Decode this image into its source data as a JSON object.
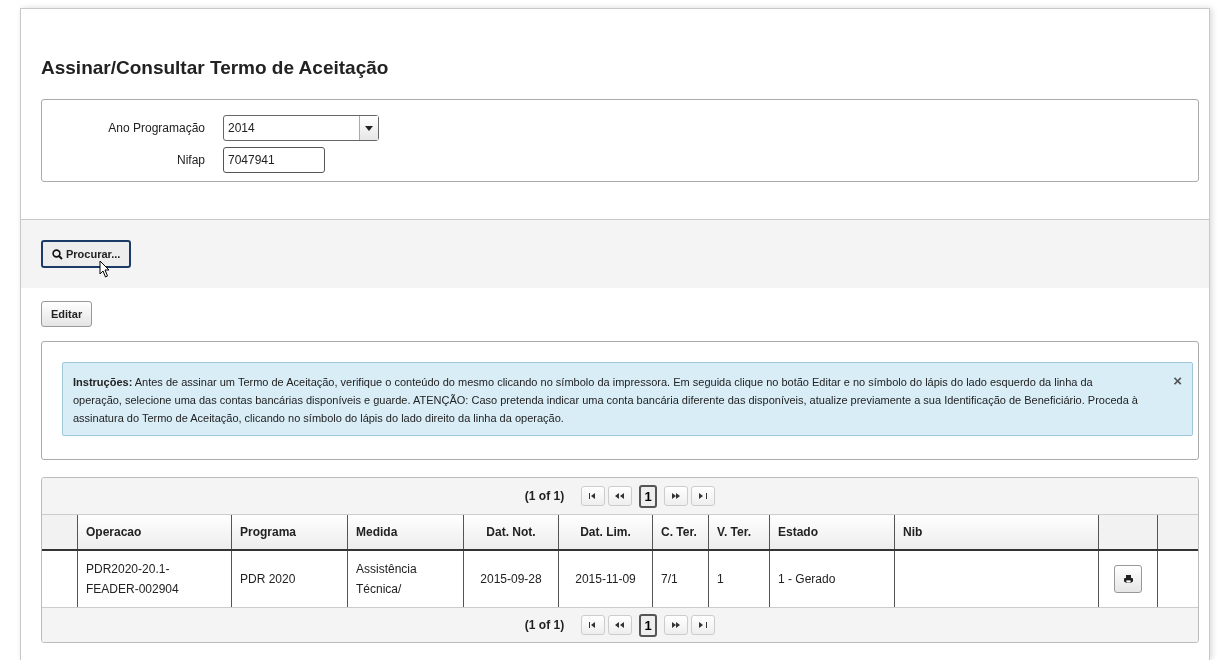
{
  "page_title": "Assinar/Consultar Termo de Aceitação",
  "form": {
    "fields": [
      {
        "kind": "select",
        "label": "Ano Programação",
        "value": "2014"
      },
      {
        "kind": "text",
        "label": "Nifap",
        "value": "7047941"
      }
    ]
  },
  "search_button": {
    "label": "Procurar...",
    "hovered": true
  },
  "edit_button": {
    "label": "Editar"
  },
  "instructions": {
    "text": "**Instruções:** Antes de assinar um Termo de Aceitação, verifique o conteúdo do mesmo clicando no símbolo da impressora. Em seguida clique no botão Editar e no símbolo do lápis do lado esquerdo da linha da operação, selecione uma das contas bancárias disponíveis e guarde. ATENÇÃO: Caso pretenda indicar uma conta bancária diferente das disponíveis, atualize previamente a sua Identificação de Beneficiário. Proceda à assinatura do Termo de Aceitação, clicando no símbolo do lápis do lado direito da linha da operação.",
    "close": "×"
  },
  "table": {
    "top_pager": {
      "info": "(1 of 1)",
      "pages": [
        {
          "label": "1",
          "selected": true
        }
      ]
    },
    "columns": [
      "Operacao",
      "Programa",
      "Medida",
      "Dat. Not.",
      "Dat. Lim.",
      "C. Ter.",
      "V. Ter.",
      "Estado",
      "Nib"
    ],
    "rows": [
      {
        "cells": [
          "PDR2020-20.1-FEADER-002904",
          "PDR 2020",
          "Assistência Técnica/",
          "2015-09-28",
          "2015-11-09",
          "7/1",
          "1",
          "1 - Gerado",
          null
        ],
        "print": true
      }
    ],
    "bottom_pager": {
      "info": "(1 of 1)",
      "pages": [
        {
          "label": "1",
          "selected": true
        }
      ]
    }
  }
}
